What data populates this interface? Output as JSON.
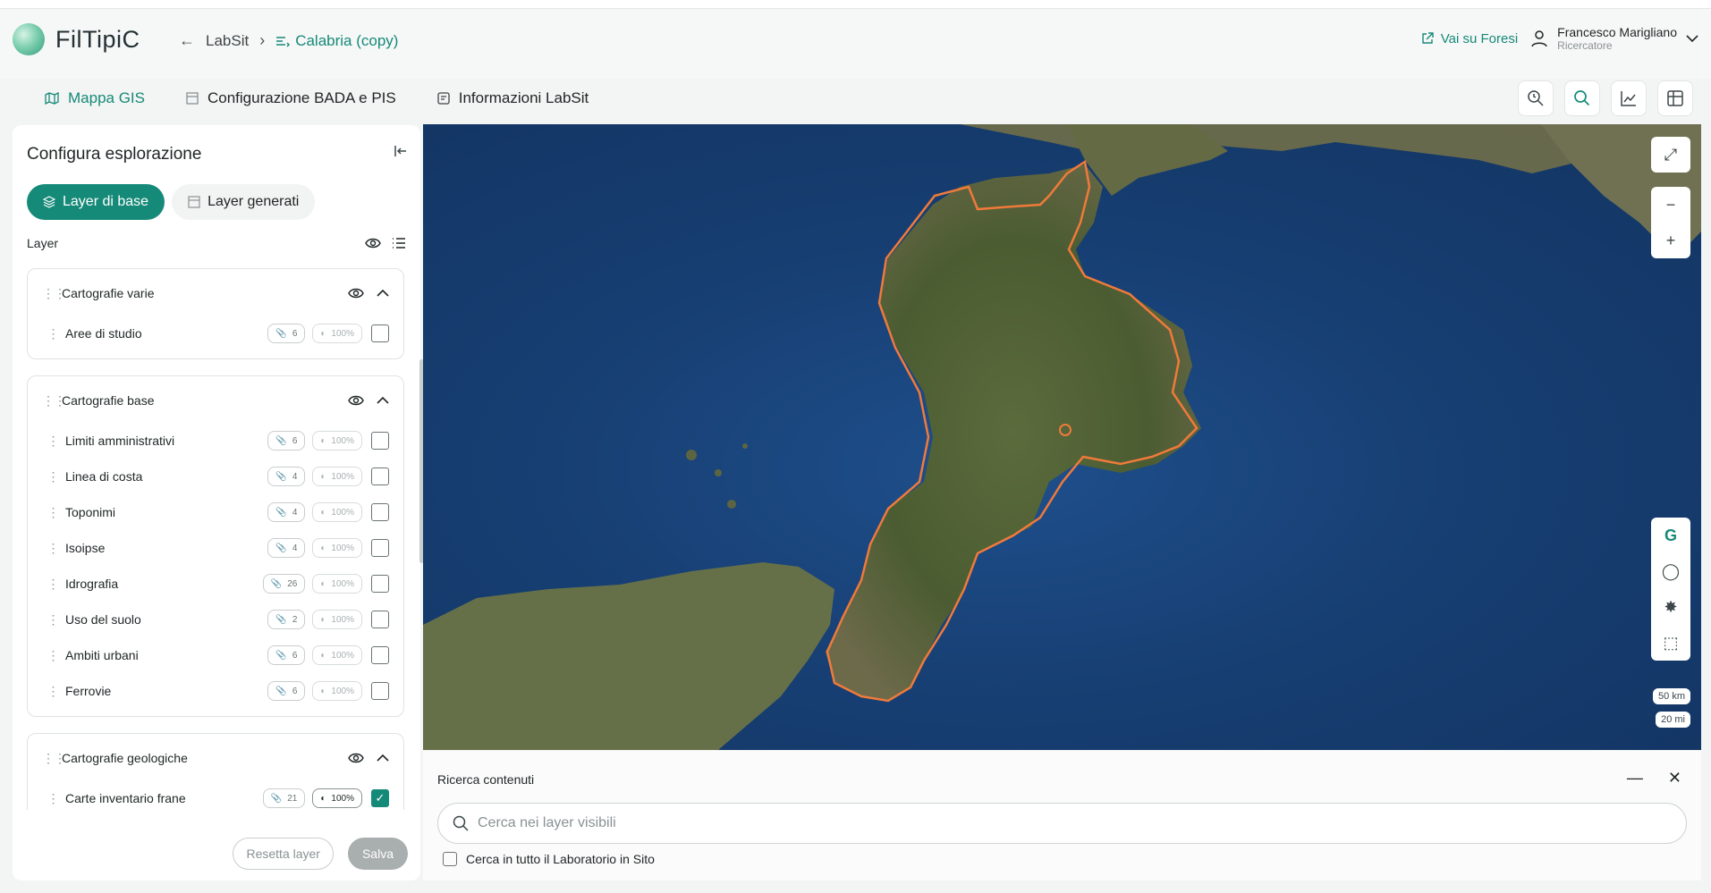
{
  "app": {
    "brand": "FilTipiC"
  },
  "breadcrumb": {
    "root": "LabSit",
    "current": "Calabria (copy)"
  },
  "header": {
    "foresi_link": "Vai su Foresi",
    "user_name": "Francesco Marigliano",
    "user_role": "Ricercatore"
  },
  "tabs": [
    {
      "label": "Mappa GIS",
      "icon": "map-icon",
      "active": true
    },
    {
      "label": "Configurazione BADA e PIS",
      "icon": "table-icon",
      "active": false
    },
    {
      "label": "Informazioni LabSit",
      "icon": "info-doc-icon",
      "active": false
    }
  ],
  "toolbar": {
    "buttons": [
      "query-icon",
      "search-icon",
      "chart-icon",
      "database-icon"
    ]
  },
  "panel": {
    "title": "Configura esplorazione",
    "seg_base": "Layer di base",
    "seg_generated": "Layer generati",
    "layer_label": "Layer",
    "groups": [
      {
        "name": "Cartografie varie",
        "rows": [
          {
            "name": "Aree di studio",
            "count": "6",
            "opacity": "100%",
            "checked": false
          }
        ]
      },
      {
        "name": "Cartografie base",
        "rows": [
          {
            "name": "Limiti amministrativi",
            "count": "6",
            "opacity": "100%",
            "checked": false
          },
          {
            "name": "Linea di costa",
            "count": "4",
            "opacity": "100%",
            "checked": false
          },
          {
            "name": "Toponimi",
            "count": "4",
            "opacity": "100%",
            "checked": false
          },
          {
            "name": "Isoipse",
            "count": "4",
            "opacity": "100%",
            "checked": false
          },
          {
            "name": "Idrografia",
            "count": "26",
            "opacity": "100%",
            "checked": false
          },
          {
            "name": "Uso del suolo",
            "count": "2",
            "opacity": "100%",
            "checked": false
          },
          {
            "name": "Ambiti urbani",
            "count": "6",
            "opacity": "100%",
            "checked": false
          },
          {
            "name": "Ferrovie",
            "count": "6",
            "opacity": "100%",
            "checked": false
          }
        ]
      },
      {
        "name": "Cartografie geologiche",
        "rows": [
          {
            "name": "Carte inventario frane",
            "count": "21",
            "opacity": "100%",
            "checked": true
          }
        ]
      }
    ],
    "reset_label": "Resetta layer",
    "save_label": "Salva"
  },
  "map": {
    "scale_km": "50 km",
    "scale_mi": "20 mi",
    "outline_color": "#f07a3a"
  },
  "search": {
    "title": "Ricerca contenuti",
    "placeholder": "Cerca nei layer visibili",
    "checkbox_label": "Cerca in tutto il Laboratorio in Sito"
  }
}
